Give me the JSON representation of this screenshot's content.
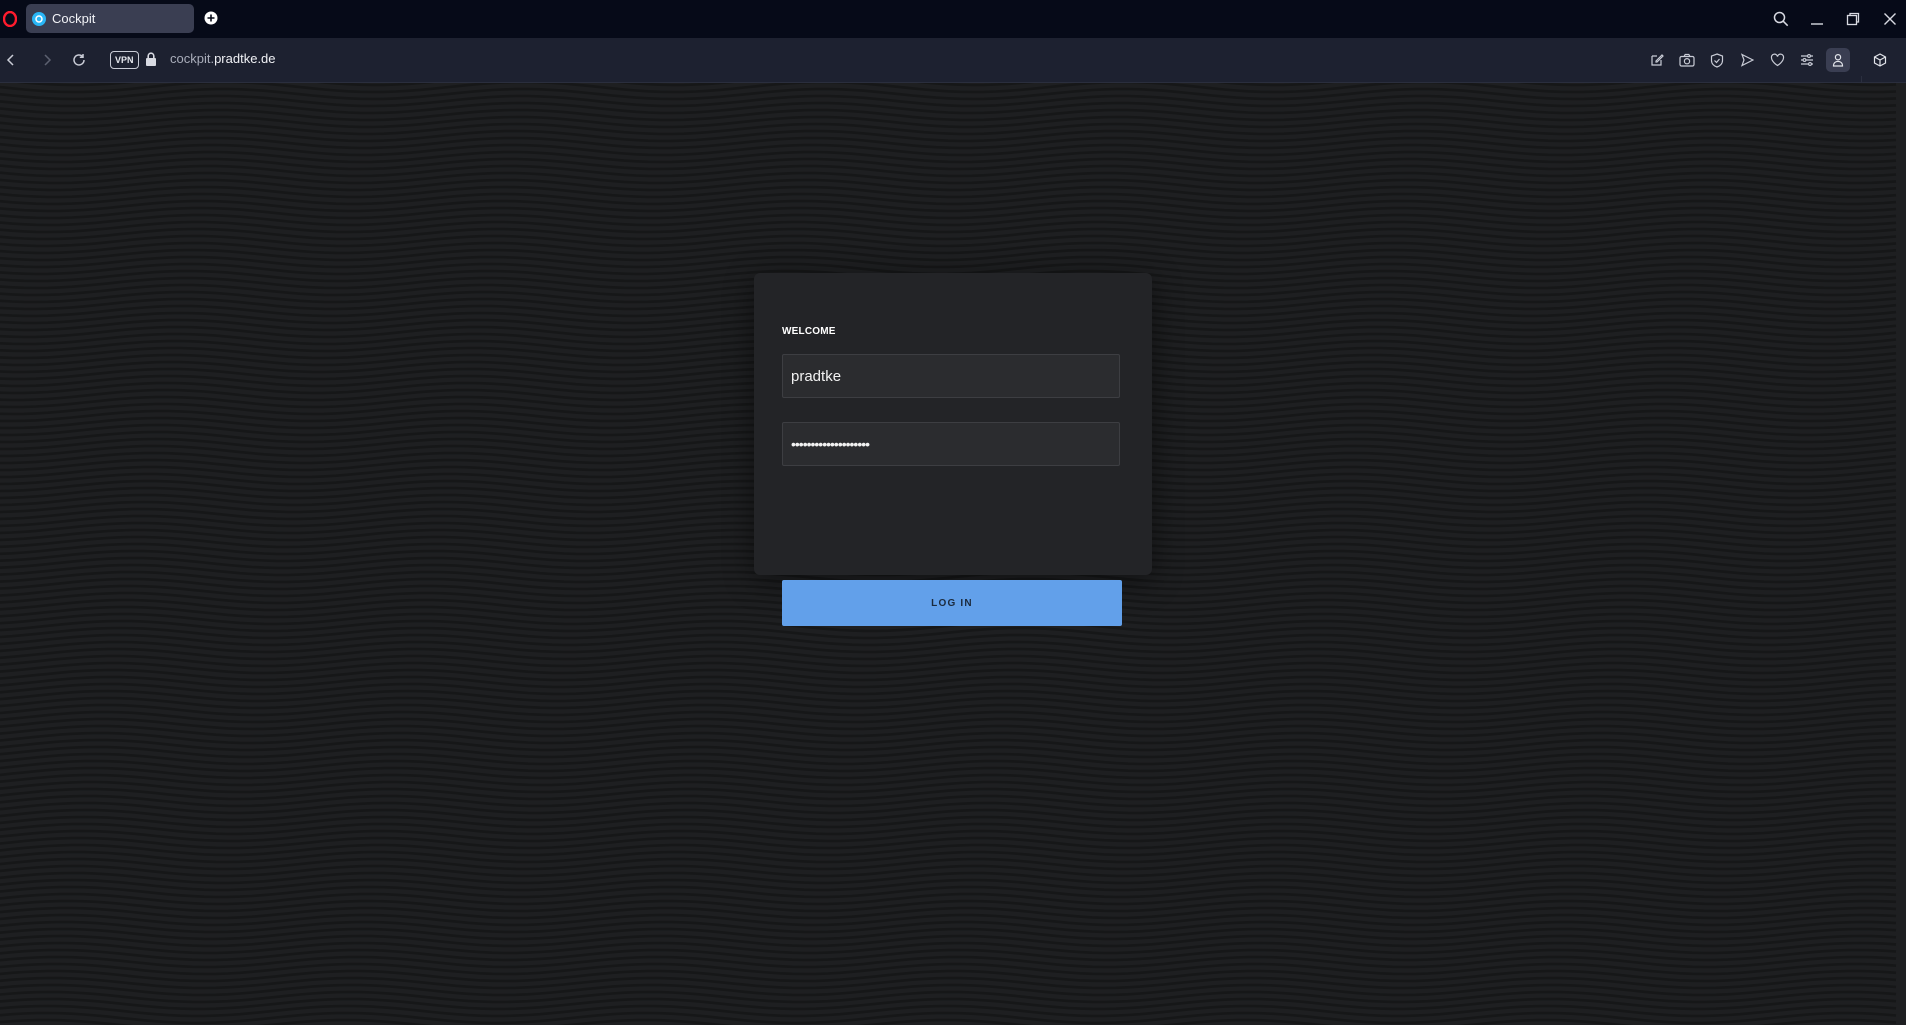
{
  "browser": {
    "tab": {
      "title": "Cockpit"
    },
    "address": {
      "vpn_label": "VPN",
      "url_prefix": "cockpit.",
      "url_host": "pradtke.de"
    },
    "accent_color": "#7b3cff"
  },
  "login": {
    "heading": "WELCOME",
    "username_value": "pradtke",
    "password_value": "••••••••••••••••••••",
    "button_label": "LOG IN",
    "button_color": "#62a0ea"
  }
}
